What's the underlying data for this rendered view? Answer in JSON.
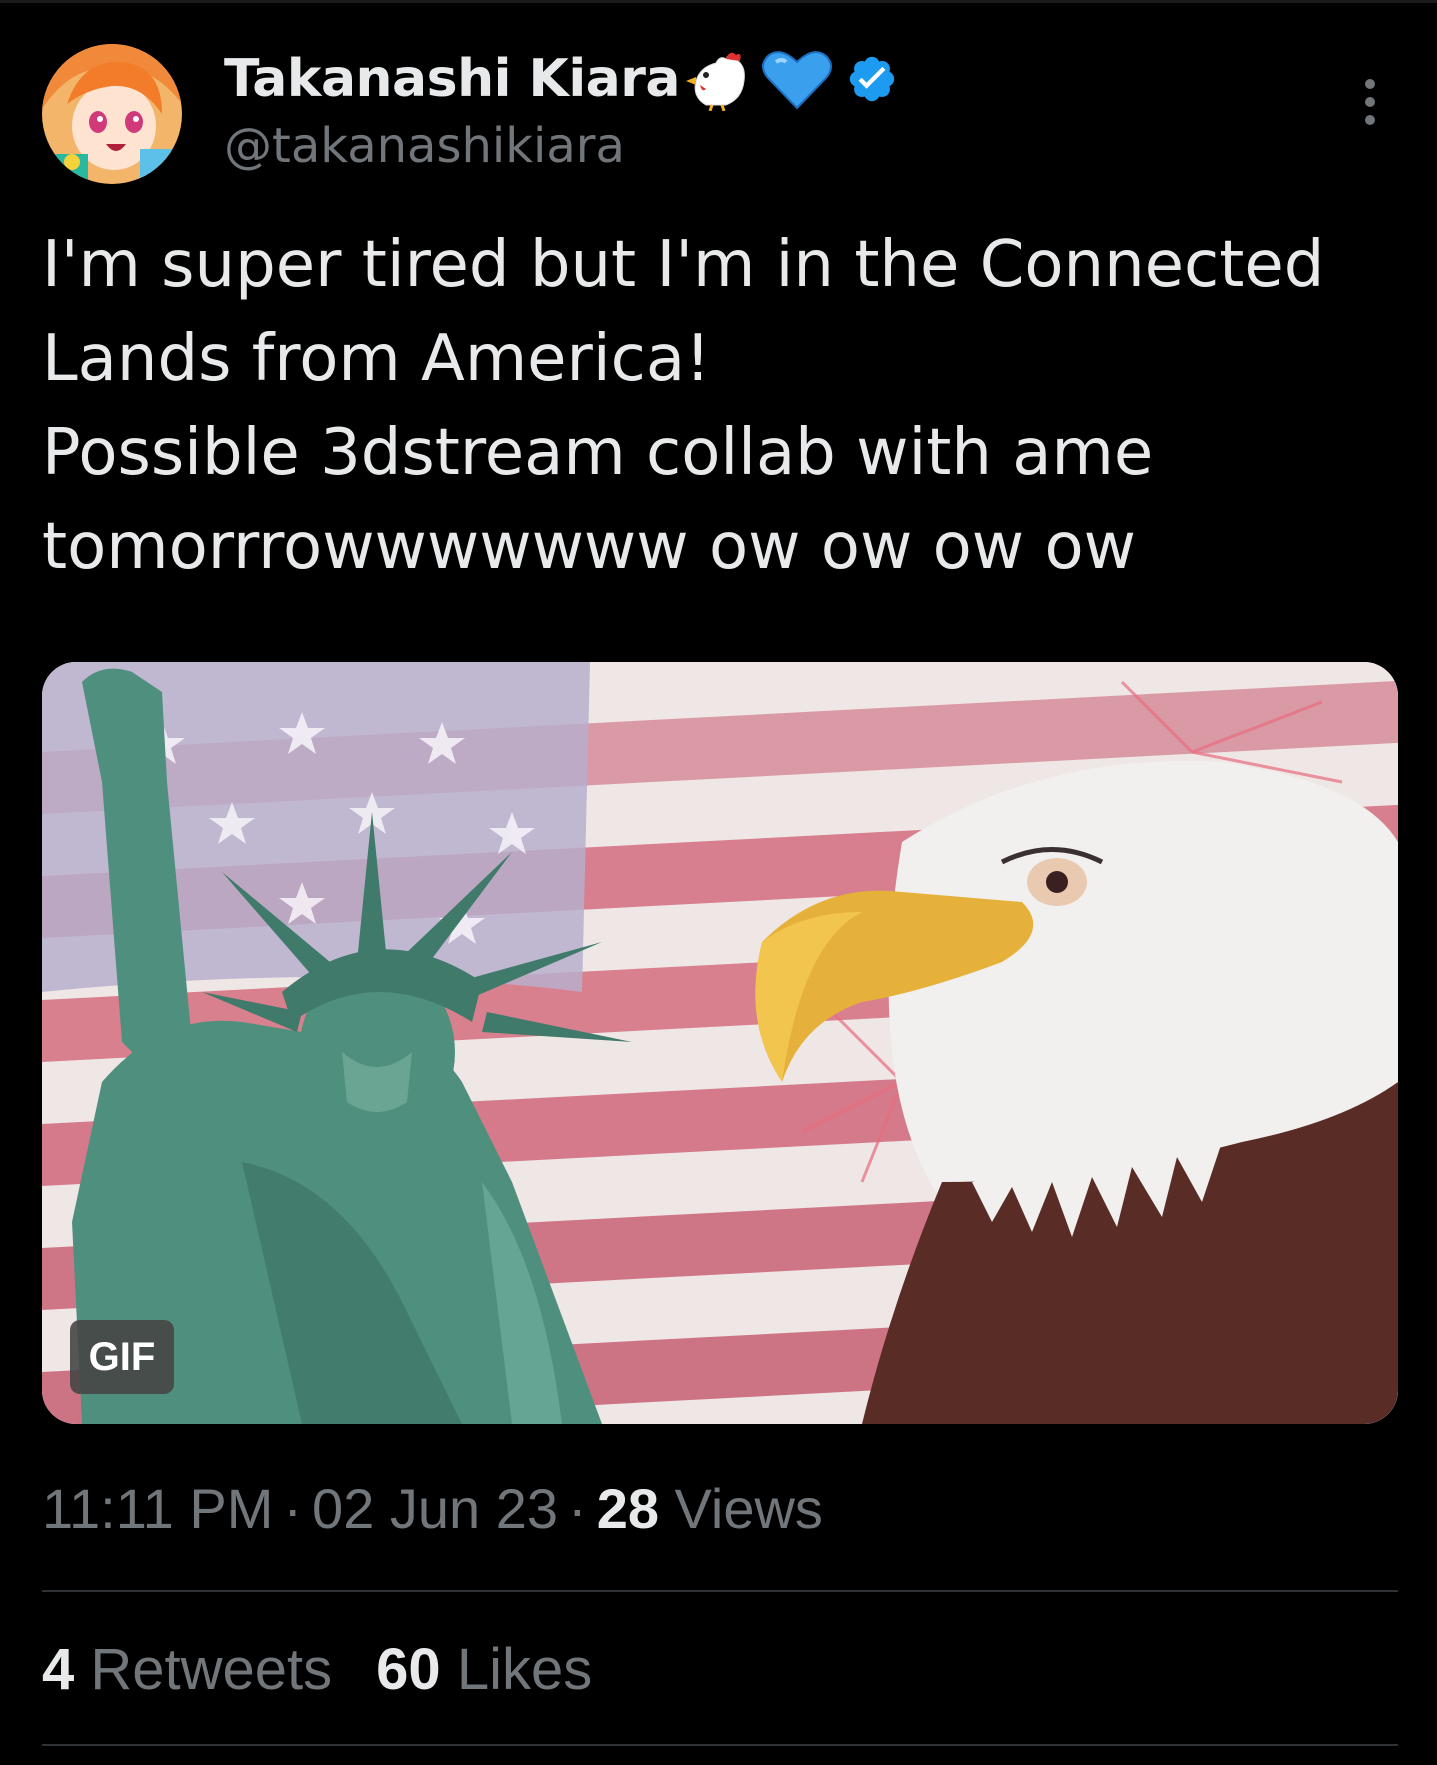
{
  "tweet": {
    "display_name": "Takanashi Kiara",
    "name_emojis": [
      "chicken-icon",
      "blue-heart-icon"
    ],
    "verified_icon": "verified-badge-icon",
    "handle": "@takanashikiara",
    "text_lines": [
      "I'm super tired but I'm in the Connected",
      "Lands from America!",
      "Possible 3dstream collab with ame",
      "tomorrrowwwwwww ow ow ow ow"
    ],
    "media": {
      "badge": "GIF"
    },
    "meta": {
      "time": "11:11 PM",
      "separator": "·",
      "date": "02 Jun 23",
      "views_count": "28",
      "views_label": "Views"
    },
    "stats": {
      "retweets_count": "4",
      "retweets_label": "Retweets",
      "likes_count": "60",
      "likes_label": "Likes"
    }
  },
  "colors": {
    "background": "#000000",
    "text_primary": "#e7e9ea",
    "text_secondary": "#71767b",
    "verified_blue": "#1d9bf0",
    "divider": "#2f3336"
  }
}
